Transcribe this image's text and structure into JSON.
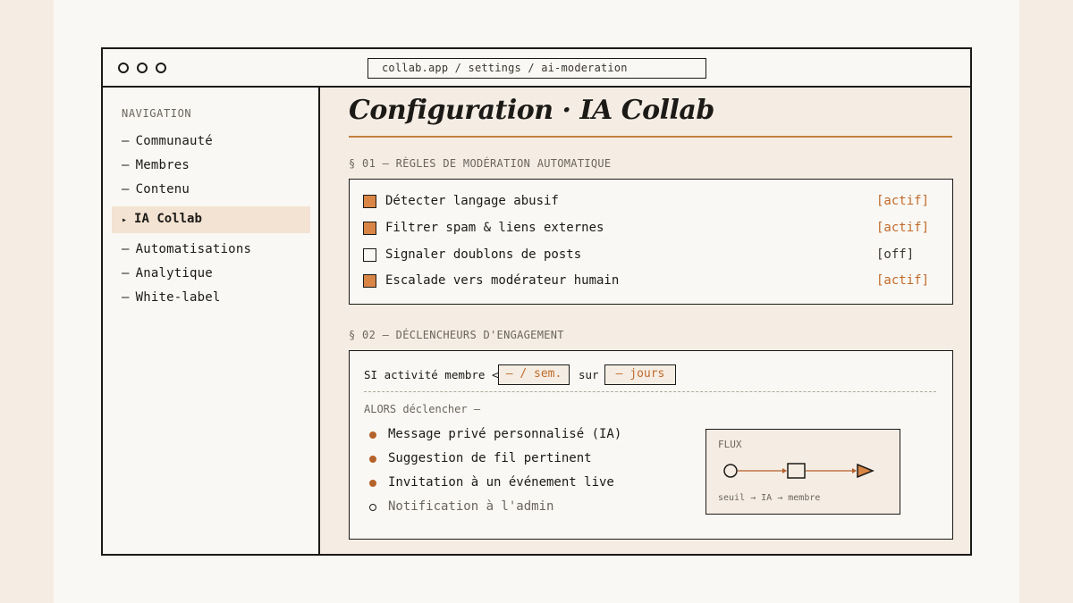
{
  "window": {
    "url": "collab.app / settings / ai-moderation"
  },
  "sidebar": {
    "heading": "NAVIGATION",
    "items": [
      {
        "label": "Communauté",
        "prefix": "—"
      },
      {
        "label": "Membres",
        "prefix": "—"
      },
      {
        "label": "Contenu",
        "prefix": "—"
      },
      {
        "label": "IA Collab",
        "prefix": "▸",
        "active": true
      },
      {
        "label": "Automatisations",
        "prefix": "—"
      },
      {
        "label": "Analytique",
        "prefix": "—"
      },
      {
        "label": "White-label",
        "prefix": "—"
      }
    ]
  },
  "main": {
    "title": "Configuration · IA Collab",
    "section1": {
      "label": "§ 01 — RÈGLES DE MODÉRATION AUTOMATIQUE",
      "rules": [
        {
          "label": "Détecter langage abusif",
          "status": "[actif]",
          "checked": true
        },
        {
          "label": "Filtrer spam & liens externes",
          "status": "[actif]",
          "checked": true
        },
        {
          "label": "Signaler doublons de posts",
          "status": "[off]",
          "checked": false
        },
        {
          "label": "Escalade vers modérateur humain",
          "status": "[actif]",
          "checked": true
        }
      ]
    },
    "section2": {
      "label": "§ 02 — DÉCLENCHEURS D'ENGAGEMENT",
      "condition_prefix": "SI activité membre <",
      "rate_field": "— / sem.",
      "connector": "sur",
      "days_field": "— jours",
      "then_label": "ALORS déclencher —",
      "actions": [
        {
          "label": "Message privé personnalisé (IA)",
          "enabled": true
        },
        {
          "label": "Suggestion de fil pertinent",
          "enabled": true
        },
        {
          "label": "Invitation à un événement live",
          "enabled": true
        },
        {
          "label": "Notification à l'admin",
          "enabled": false
        }
      ],
      "flux": {
        "title": "FLUX",
        "caption": "seuil → IA → membre"
      }
    }
  },
  "colors": {
    "accent": "#d98545",
    "accent_text": "#c06a2b",
    "background": "#f5ede4",
    "ink": "#1c1a17"
  }
}
